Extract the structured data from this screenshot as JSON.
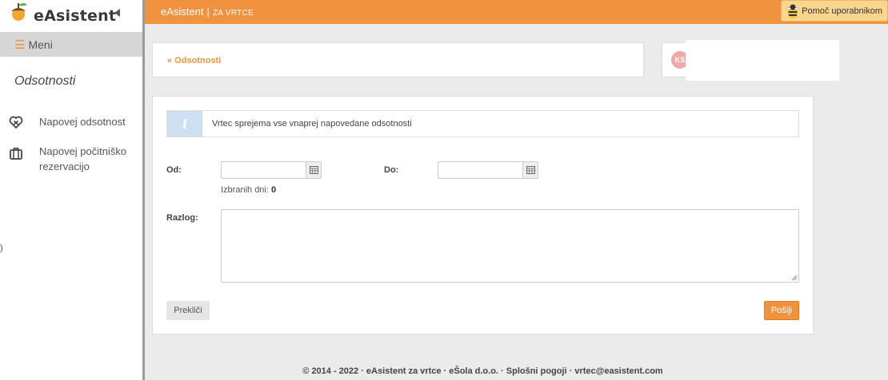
{
  "sidebar": {
    "logo_text": "eAsistent",
    "menu_label": "Meni",
    "section_title": "Odsotnosti",
    "items": [
      {
        "label": "Napovej odsotnost",
        "icon": "heart-x-icon"
      },
      {
        "label": "Napovej počitniško rezervacijo",
        "icon": "suitcase-icon"
      }
    ],
    "stray_glyph": ")"
  },
  "topbar": {
    "brand": "eAsistent",
    "brand_sep": "|",
    "brand_sub": "ZA VRTCE",
    "help_label": "Pomoč uporabnikom",
    "color": "#f0923e"
  },
  "breadcrumb": {
    "back_link": "« Odsotnosti"
  },
  "user": {
    "initials": "KS"
  },
  "form": {
    "info_text": "Vrtec sprejema vse vnaprej napovedane odsotnosti",
    "from_label": "Od:",
    "from_value": "",
    "to_label": "Do:",
    "to_value": "",
    "days_label": "Izbranih dni:",
    "days_value": "0",
    "reason_label": "Razlog:",
    "reason_value": "",
    "cancel_label": "Prekliči",
    "send_label": "Pošlji"
  },
  "footer": {
    "text": "© 2014 - 2022 · eAsistent za vrtce · eŠola d.o.o. · Splošni pogoji · vrtec@easistent.com"
  }
}
